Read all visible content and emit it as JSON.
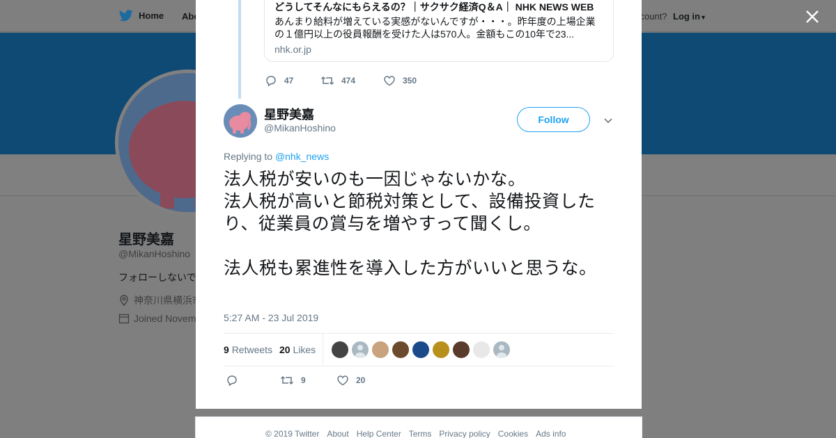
{
  "topbar": {
    "home_label": "Home",
    "about_label": "Abo",
    "account_prompt": "ccount?",
    "login_label": "Log in"
  },
  "profile": {
    "name": "星野美嘉",
    "handle": "@MikanHoshino",
    "bio": "フォローしないで",
    "location": "神奈川県横浜市",
    "joined": "Joined Novemb"
  },
  "quoted_card": {
    "title": "どうしてそんなにもらえるの？｜サクサク経済Q＆A｜ NHK NEWS WEB",
    "description": "あんまり給料が増えている実感がないんですが・・・。昨年度の上場企業の１億円以上の役員報酬を受けた人は570人。金額もこの10年で23...",
    "domain": "nhk.or.jp"
  },
  "parent_actions": {
    "replies": "47",
    "retweets": "474",
    "likes": "350"
  },
  "tweet": {
    "author_name": "星野美嘉",
    "author_handle": "@MikanHoshino",
    "follow_label": "Follow",
    "replying_prefix": "Replying to ",
    "replying_handle": "@nhk_news",
    "text": "法人税が安いのも一因じゃないかな。\n法人税が高いと節税対策として、設備投資したり、従業員の賞与を増やすって聞くし。\n\n法人税も累進性を導入した方がいいと思うな。",
    "timestamp": "5:27 AM - 23 Jul 2019",
    "retweet_count": "9",
    "retweet_label": "Retweets",
    "like_count": "20",
    "like_label": "Likes",
    "action_retweets": "9",
    "action_likes": "20"
  },
  "likers": [
    {
      "icon": "avatar-face-1",
      "color": "#444444"
    },
    {
      "icon": "avatar-default",
      "color": "#aab8c2"
    },
    {
      "icon": "avatar-cat",
      "color": "#c9a27e"
    },
    {
      "icon": "avatar-dog",
      "color": "#6b4a2e"
    },
    {
      "icon": "avatar-anime",
      "color": "#1a4a8a"
    },
    {
      "icon": "avatar-figure",
      "color": "#b8901c"
    },
    {
      "icon": "avatar-logo",
      "color": "#5a3a2a"
    },
    {
      "icon": "avatar-plane",
      "color": "#e8e8e8"
    },
    {
      "icon": "avatar-default",
      "color": "#aab8c2"
    }
  ],
  "footer": {
    "links": [
      "© 2019 Twitter",
      "About",
      "Help Center",
      "Terms",
      "Privacy policy",
      "Cookies",
      "Ads info"
    ]
  },
  "colors": {
    "accent": "#1da1f2",
    "text_secondary": "#657786",
    "banner": "#0e4a73",
    "overlay": "#7f7f7f"
  }
}
